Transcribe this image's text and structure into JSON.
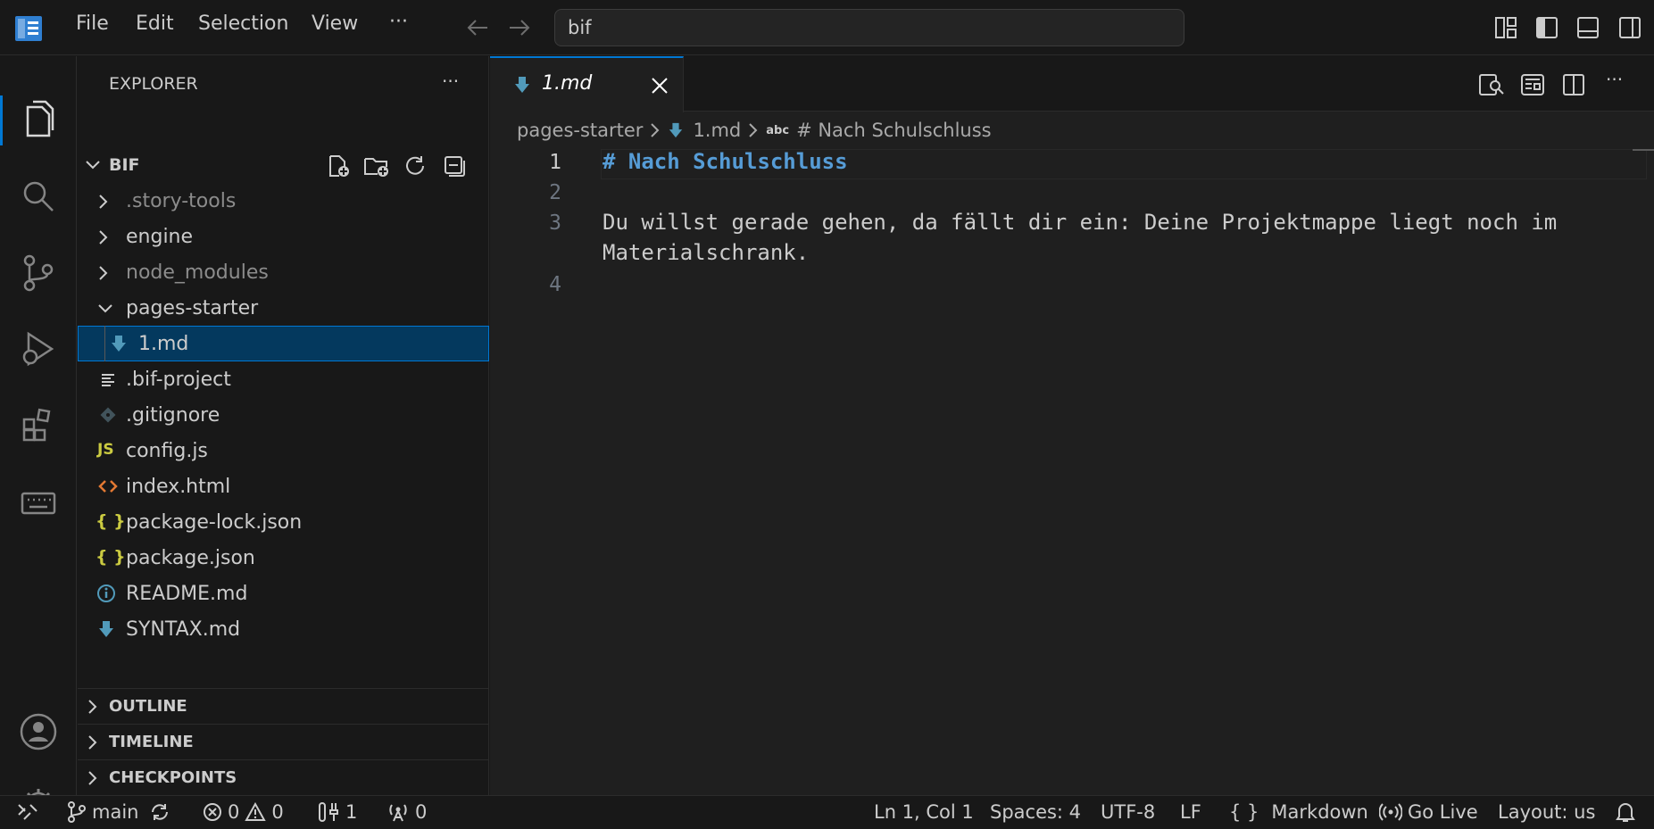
{
  "titlebar": {
    "menu": [
      "File",
      "Edit",
      "Selection",
      "View",
      "···"
    ],
    "search_value": "bif"
  },
  "sidebar": {
    "title": "EXPLORER",
    "more": "···",
    "root": "BIF",
    "items": [
      {
        "label": ".story-tools",
        "type": "folder"
      },
      {
        "label": "engine",
        "type": "folder"
      },
      {
        "label": "node_modules",
        "type": "folder"
      },
      {
        "label": "pages-starter",
        "type": "folder-open"
      },
      {
        "label": "1.md",
        "type": "md"
      },
      {
        "label": ".bif-project",
        "type": "text"
      },
      {
        "label": ".gitignore",
        "type": "git"
      },
      {
        "label": "config.js",
        "type": "js"
      },
      {
        "label": "index.html",
        "type": "html"
      },
      {
        "label": "package-lock.json",
        "type": "json"
      },
      {
        "label": "package.json",
        "type": "json"
      },
      {
        "label": "README.md",
        "type": "info"
      },
      {
        "label": "SYNTAX.md",
        "type": "md"
      }
    ],
    "js_badge": "JS",
    "json_badge": "{ }",
    "sections": [
      "OUTLINE",
      "TIMELINE",
      "CHECKPOINTS"
    ]
  },
  "editor": {
    "tab_label": "1.md",
    "breadcrumb": {
      "folder": "pages-starter",
      "file": "1.md",
      "symbol_prefix": "abc",
      "symbol": "# Nach Schulschluss"
    },
    "line_numbers": [
      "1",
      "2",
      "3",
      "",
      "4"
    ],
    "lines": [
      "# Nach Schulschluss",
      "",
      "Du willst gerade gehen, da fällt dir ein: Deine Projektmappe liegt noch im",
      "Materialschrank.",
      ""
    ]
  },
  "statusbar": {
    "branch": "main",
    "errors": "0",
    "warnings": "0",
    "ports": "1",
    "broadcast": "0",
    "position": "Ln 1, Col 1",
    "spaces": "Spaces: 4",
    "encoding": "UTF-8",
    "eol": "LF",
    "language": "Markdown",
    "language_icon": "{ }",
    "golive": "Go Live",
    "layout": "Layout: us"
  },
  "colors": {
    "accent": "#0078d4",
    "heading": "#569cd6",
    "md_icon": "#519aba",
    "js_icon": "#cbcb41",
    "html_icon": "#e37933"
  }
}
